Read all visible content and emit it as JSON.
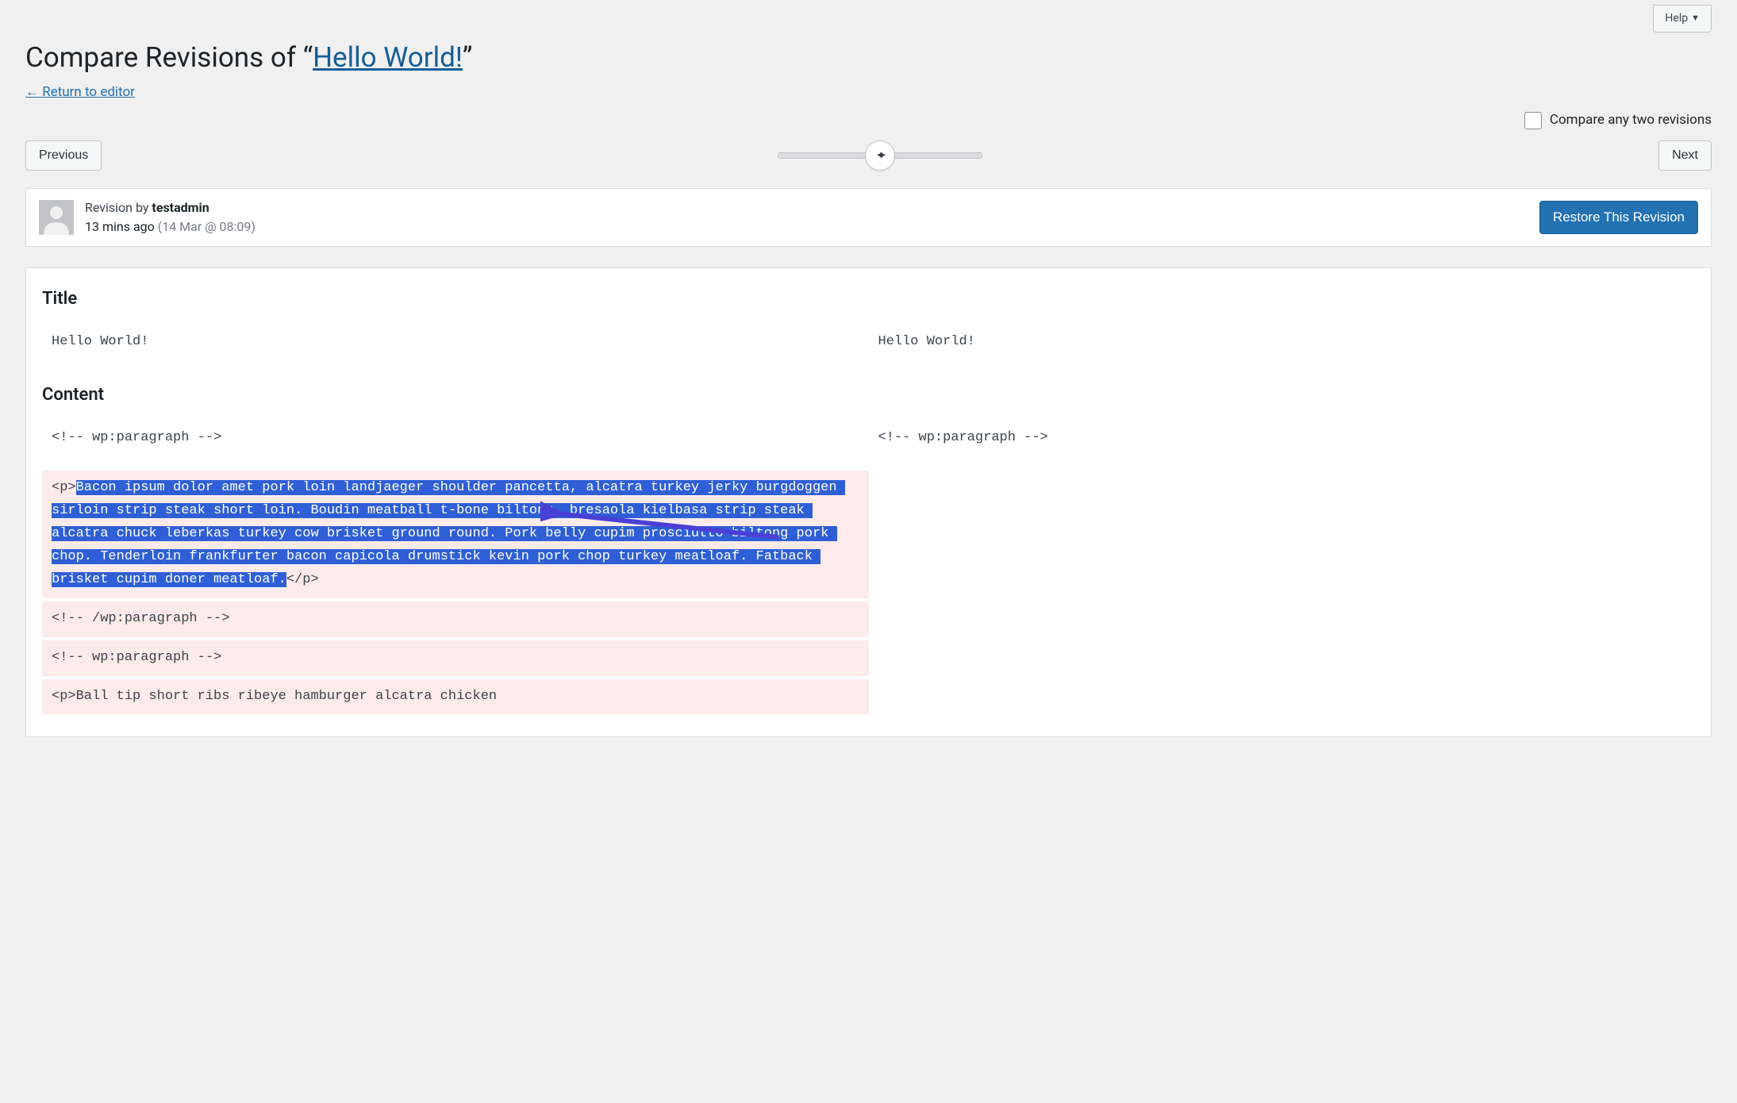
{
  "header": {
    "help_label": "Help",
    "heading_prefix": "Compare Revisions of “",
    "heading_link": "Hello World!",
    "heading_suffix": "”",
    "return_link": "← Return to editor"
  },
  "options": {
    "compare_any_label": "Compare any two revisions"
  },
  "nav": {
    "previous": "Previous",
    "next": "Next"
  },
  "revision": {
    "by_prefix": "Revision by ",
    "author": "testadmin",
    "time_relative": "13 mins ago",
    "time_absolute": "(14 Mar @ 08:09)",
    "restore_label": "Restore This Revision"
  },
  "diff": {
    "title_label": "Title",
    "title_left": "Hello World!",
    "title_right": "Hello World!",
    "content_label": "Content",
    "rows": [
      {
        "type": "context",
        "left": "<!-- wp:paragraph -->",
        "right": "<!-- wp:paragraph -->"
      },
      {
        "type": "deleted",
        "left_prefix": "<p>",
        "left_del": "Bacon ipsum dolor amet pork loin landjaeger shoulder pancetta, alcatra turkey jerky burgdoggen sirloin strip steak short loin. Boudin meatball t-bone biltong, bresaola kielbasa strip steak alcatra chuck leberkas turkey cow brisket ground round. Pork belly cupim prosciutto biltong pork chop. Tenderloin frankfurter bacon capicola drumstick kevin pork chop turkey meatloaf. Fatback brisket cupim doner meatloaf.",
        "left_suffix": "</p>",
        "right": ""
      },
      {
        "type": "deleted-plain",
        "left": "<!-- /wp:paragraph -->",
        "right": ""
      },
      {
        "type": "deleted-plain",
        "left": "<!-- wp:paragraph -->",
        "right": ""
      },
      {
        "type": "deleted-plain",
        "left": "<p>Ball tip short ribs ribeye hamburger alcatra chicken",
        "right": ""
      }
    ]
  }
}
